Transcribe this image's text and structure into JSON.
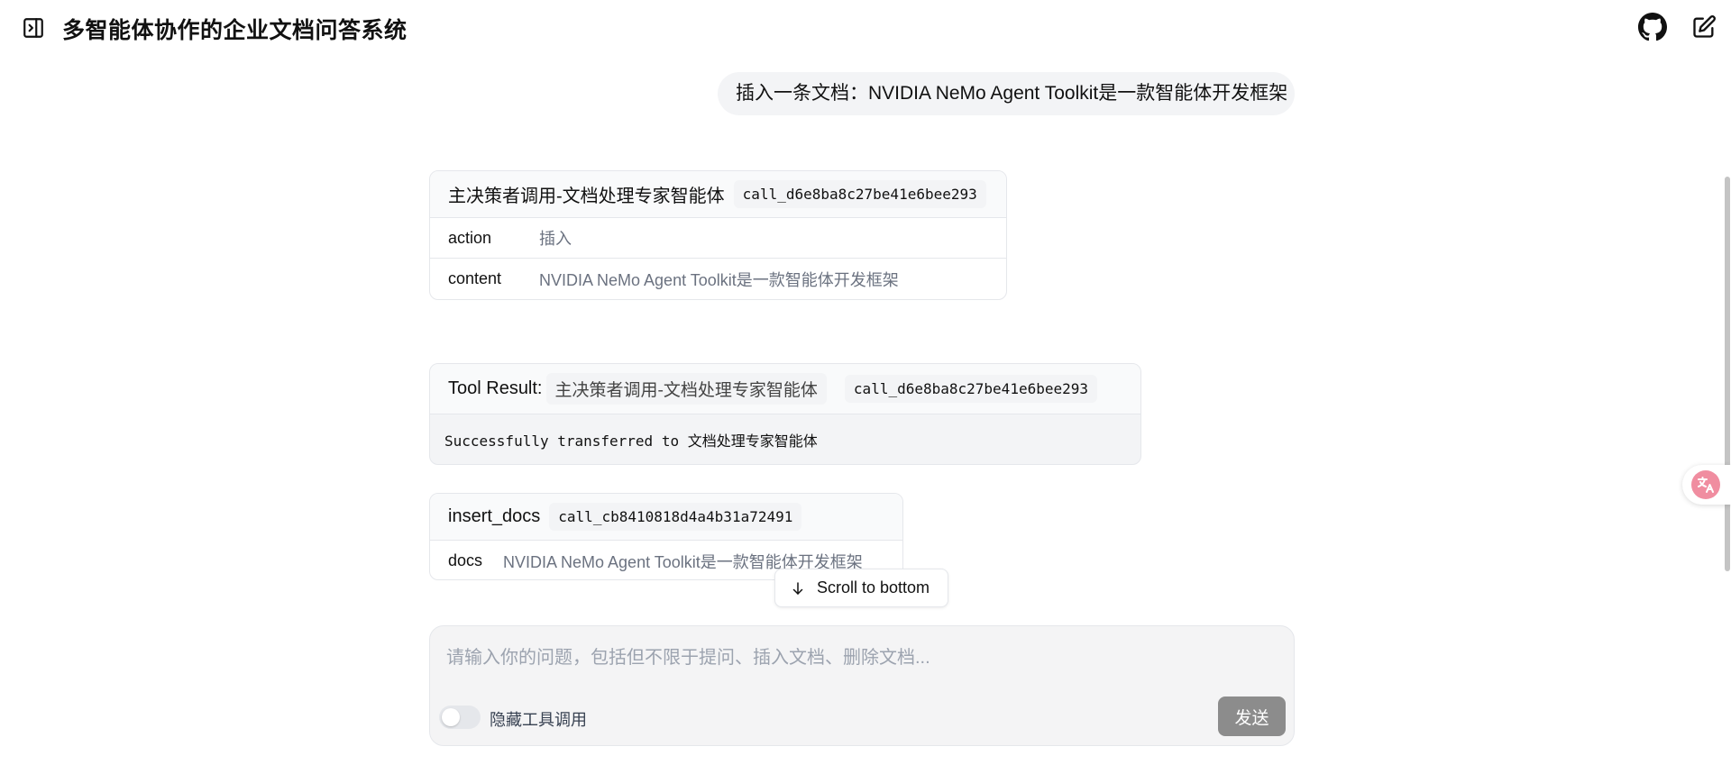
{
  "header": {
    "title": "多智能体协作的企业文档问答系统"
  },
  "icons": {
    "sidebar_toggle": "sidebar-toggle-icon",
    "github": "github-icon",
    "new_chat": "edit-icon",
    "scroll_down": "arrow-down-icon",
    "translate": "translate-icon"
  },
  "user_message": "插入一条文档：NVIDIA NeMo Agent Toolkit是一款智能体开发框架",
  "tool_call_1": {
    "title": "主决策者调用-文档处理专家智能体",
    "call_id": "call_d6e8ba8c27be41e6bee293",
    "rows": [
      {
        "key": "action",
        "value": "插入"
      },
      {
        "key": "content",
        "value": "NVIDIA NeMo Agent Toolkit是一款智能体开发框架"
      }
    ]
  },
  "tool_result": {
    "label": "Tool Result:",
    "name": "主决策者调用-文档处理专家智能体",
    "call_id": "call_d6e8ba8c27be41e6bee293",
    "text": "Successfully transferred to 文档处理专家智能体"
  },
  "tool_call_2": {
    "title": "insert_docs",
    "call_id": "call_cb8410818d4a4b31a72491",
    "rows": [
      {
        "key": "docs",
        "value": "NVIDIA NeMo Agent Toolkit是一款智能体开发框架"
      }
    ]
  },
  "scroll_to_bottom": "Scroll to bottom",
  "composer": {
    "placeholder": "请输入你的问题，包括但不限于提问、插入文档、删除文档...",
    "value": "",
    "toggle_label": "隐藏工具调用",
    "toggle_on": false,
    "send_label": "发送"
  },
  "colors": {
    "send_button": "#8c8c8c",
    "bubble_bg": "#f3f4f6",
    "translate_accent": "#f08da0"
  }
}
